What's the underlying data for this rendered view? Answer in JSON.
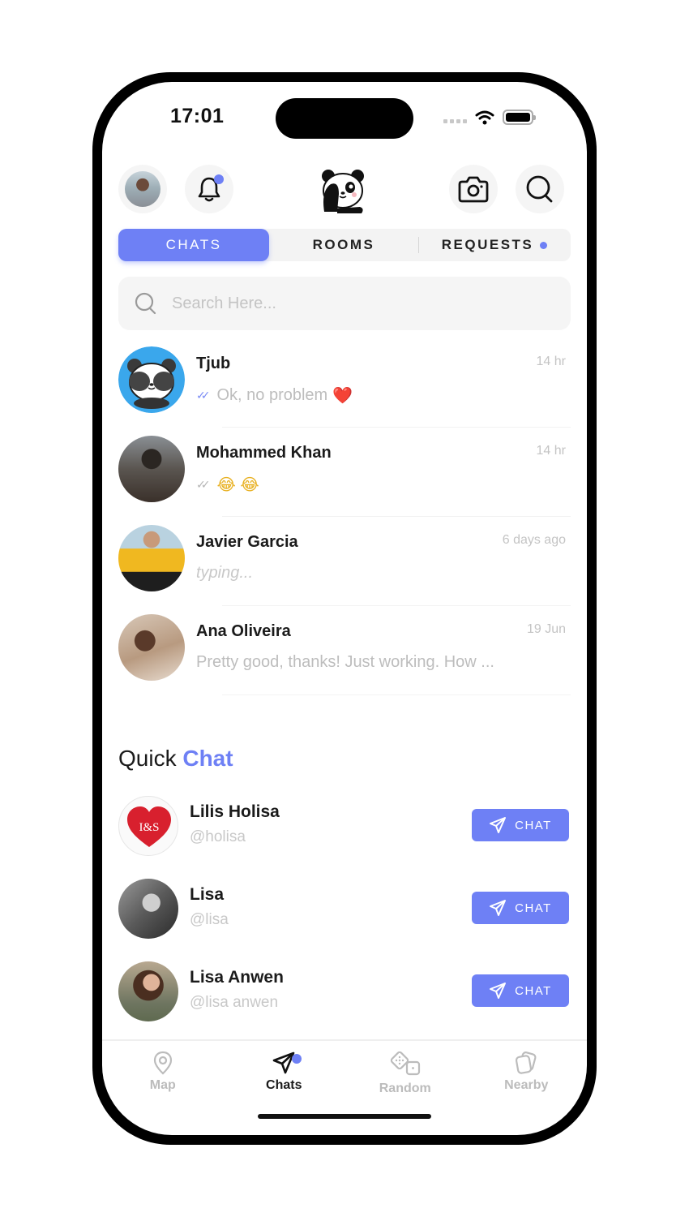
{
  "status_bar": {
    "time": "17:01"
  },
  "header": {
    "profile_icon": "user-avatar",
    "notification_icon": "bell-icon",
    "logo": "panda-logo",
    "camera_icon": "camera-icon",
    "search_icon": "search-icon",
    "accent_color": "#6e80f5"
  },
  "tabs": [
    {
      "label": "CHATS",
      "active": true
    },
    {
      "label": "ROOMS",
      "active": false
    },
    {
      "label": "REQUESTS",
      "active": false,
      "has_dot": true
    }
  ],
  "search": {
    "placeholder": "Search Here..."
  },
  "chats": [
    {
      "name": "Tjub",
      "time": "14 hr",
      "preview": "Ok, no problem",
      "emoji": "❤️",
      "tick": "read"
    },
    {
      "name": "Mohammed Khan",
      "time": "14 hr",
      "preview": "",
      "emoji": "😂 😂",
      "tick": "sent"
    },
    {
      "name": "Javier Garcia",
      "time": "6 days ago",
      "preview": "typing...",
      "emoji": "",
      "tick": ""
    },
    {
      "name": "Ana Oliveira",
      "time": "19 Jun",
      "preview": "Pretty good, thanks! Just working. How ...",
      "emoji": "",
      "tick": ""
    }
  ],
  "quick_chat": {
    "title_plain": "Quick",
    "title_accent": "Chat",
    "button_label": "CHAT",
    "users": [
      {
        "name": "Lilis Holisa",
        "handle": "@holisa",
        "avatar_text": "I&S"
      },
      {
        "name": "Lisa",
        "handle": "@lisa"
      },
      {
        "name": "Lisa Anwen",
        "handle": "@lisa anwen"
      }
    ]
  },
  "bottom_nav": [
    {
      "label": "Map",
      "icon": "map-pin-icon",
      "active": false
    },
    {
      "label": "Chats",
      "icon": "send-icon",
      "active": true
    },
    {
      "label": "Random",
      "icon": "dice-icon",
      "active": false
    },
    {
      "label": "Nearby",
      "icon": "cards-icon",
      "active": false
    }
  ]
}
